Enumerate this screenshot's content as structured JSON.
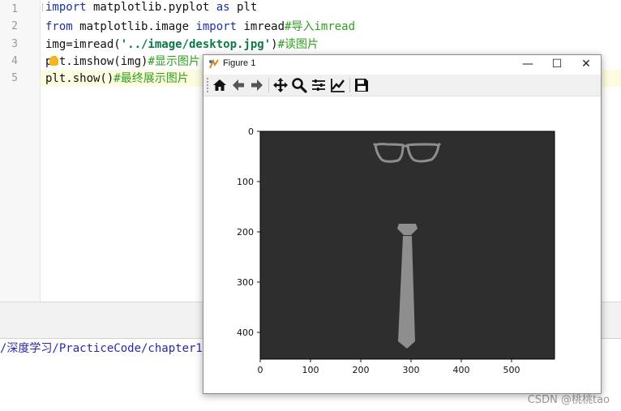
{
  "editor": {
    "line_numbers": [
      "1",
      "2",
      "3",
      "4",
      "5"
    ],
    "lines": [
      {
        "kw1": "import",
        "t1": " matplotlib.pyplot ",
        "kw2": "as",
        "t2": " plt"
      },
      {
        "kw1": "from",
        "t1": " matplotlib.image ",
        "kw2": "import",
        "t2": " imread",
        "cm": "#导入imread"
      },
      {
        "t1": "img=imread(",
        "str": "'../image/desktop.jpg'",
        "t2": ")",
        "cm": "#读图片"
      },
      {
        "t1": "plt.imshow(img)",
        "cm": "#显示图片"
      },
      {
        "t1": "plt.show()",
        "cm": "#最终展示图片"
      }
    ]
  },
  "console": {
    "path": "/深度学习/PracticeCode/chapter1/"
  },
  "watermark": "CSDN @桃桃tao",
  "figure_window": {
    "title": "Figure 1",
    "minimize": "—",
    "maximize": "☐",
    "close": "✕",
    "toolbar": {
      "tools": [
        "home-icon",
        "back-arrow-icon",
        "forward-arrow-icon",
        "pan-icon",
        "zoom-icon",
        "subplots-config-icon",
        "axes-edit-icon",
        "save-icon"
      ]
    },
    "plot": {
      "x_ticks": [
        "0",
        "100",
        "200",
        "300",
        "400",
        "500"
      ],
      "y_ticks": [
        "0",
        "100",
        "200",
        "300",
        "400"
      ],
      "image_background": "#2e2e2e",
      "image_objects": [
        "glasses",
        "necktie"
      ]
    }
  }
}
